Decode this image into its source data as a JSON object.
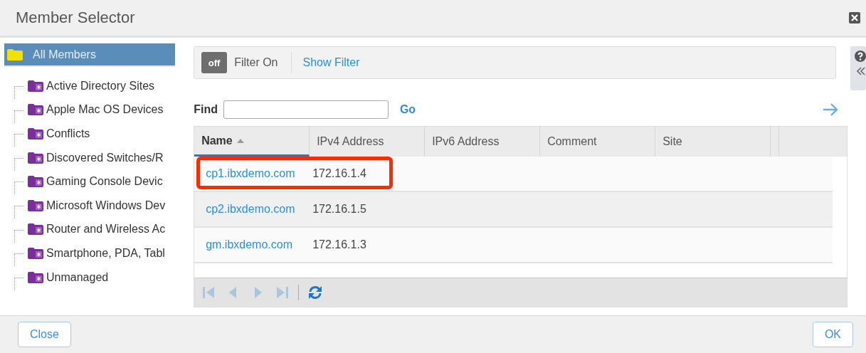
{
  "window": {
    "title": "Member Selector"
  },
  "tree": {
    "root": {
      "label": "All Members",
      "selected": true
    },
    "children": [
      {
        "label": "Active Directory Sites",
        "selected": false
      },
      {
        "label": "Apple Mac OS Devices",
        "selected": false
      },
      {
        "label": "Conflicts",
        "selected": false
      },
      {
        "label": "Discovered Switches/R",
        "selected": false
      },
      {
        "label": "Gaming Console Devic",
        "selected": false
      },
      {
        "label": "Microsoft Windows Dev",
        "selected": false
      },
      {
        "label": "Router and Wireless Ac",
        "selected": false
      },
      {
        "label": "Smartphone, PDA, Tabl",
        "selected": false
      },
      {
        "label": "Unmanaged",
        "selected": false
      }
    ]
  },
  "filter": {
    "toggle": "off",
    "on": false,
    "label": "Filter On",
    "link": "Show Filter"
  },
  "find": {
    "label": "Find",
    "go": "Go"
  },
  "table": {
    "columns": [
      {
        "label": "Name",
        "sorted": true
      },
      {
        "label": "IPv4 Address",
        "sorted": false
      },
      {
        "label": "IPv6 Address",
        "sorted": false
      },
      {
        "label": "Comment",
        "sorted": false
      },
      {
        "label": "Site",
        "sorted": false
      }
    ],
    "rows": [
      {
        "name": "cp1.ibxdemo.com",
        "ipv4": "172.16.1.4",
        "highlighted": true
      },
      {
        "name": "cp2.ibxdemo.com",
        "ipv4": "172.16.1.5",
        "highlighted": false
      },
      {
        "name": "gm.ibxdemo.com",
        "ipv4": "172.16.1.3",
        "highlighted": false
      }
    ]
  },
  "pager": [
    {
      "kind": "first",
      "disabled": true
    },
    {
      "kind": "prev",
      "disabled": true
    },
    {
      "kind": "next",
      "disabled": true
    },
    {
      "kind": "last",
      "disabled": true
    },
    {
      "kind": "refresh",
      "disabled": false
    }
  ],
  "buttons": {
    "close": "Close",
    "ok": "OK"
  }
}
